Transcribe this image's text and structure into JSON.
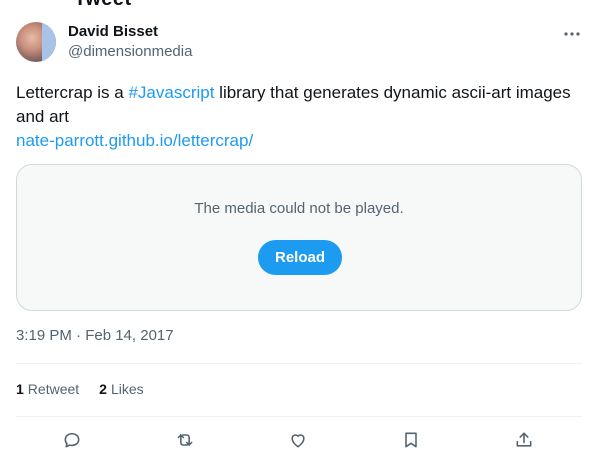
{
  "header": {
    "title_fragment": "Tweet"
  },
  "author": {
    "name": "David Bisset",
    "handle": "@dimensionmedia"
  },
  "tweet": {
    "text_before": "Lettercrap is a ",
    "hashtag": "#Javascript",
    "text_after": " library that generates dynamic ascii-art images and art",
    "url": "nate-parrott.github.io/lettercrap/"
  },
  "media": {
    "message": "The media could not be played.",
    "reload_label": "Reload"
  },
  "timestamp": "3:19 PM · Feb 14, 2017",
  "stats": {
    "retweets_count": "1",
    "retweets_label": "Retweet",
    "likes_count": "2",
    "likes_label": "Likes"
  },
  "icons": {
    "more": "more-dots-icon",
    "reply": "reply-icon",
    "retweet": "retweet-icon",
    "like": "heart-icon",
    "bookmark": "bookmark-icon",
    "share": "share-icon"
  },
  "colors": {
    "accent": "#1d9bf0",
    "muted": "#536471",
    "text": "#0f1419"
  }
}
